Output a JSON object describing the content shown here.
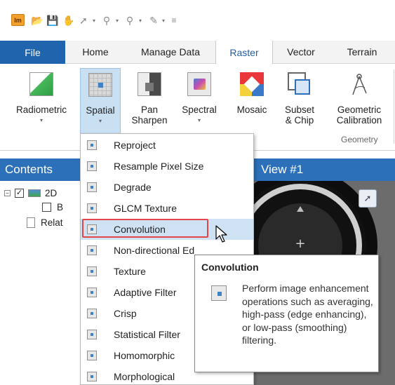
{
  "quick_access": {
    "logo_text": "Im",
    "icons": [
      "open-folder-icon",
      "save-icon",
      "pan-icon",
      "select-icon",
      "zoom-in-icon",
      "zoom-out-icon",
      "draw-icon",
      "customize-icon"
    ]
  },
  "tabs": [
    {
      "label": "File"
    },
    {
      "label": "Home"
    },
    {
      "label": "Manage Data"
    },
    {
      "label": "Raster"
    },
    {
      "label": "Vector"
    },
    {
      "label": "Terrain"
    }
  ],
  "ribbon": {
    "buttons": [
      {
        "label": "Radiometric",
        "icon": "radiometric-icon"
      },
      {
        "label": "Spatial",
        "icon": "spatial-icon"
      },
      {
        "label": "Pan\nSharpen",
        "icon": "pan-sharpen-icon"
      },
      {
        "label": "Spectral",
        "icon": "spectral-icon"
      },
      {
        "label": "Mosaic",
        "icon": "mosaic-icon"
      },
      {
        "label": "Subset\n& Chip",
        "icon": "subset-chip-icon"
      },
      {
        "label": "Geometric\nCalibration",
        "icon": "geometric-calibration-icon"
      }
    ],
    "group_label": "Geometry"
  },
  "contents": {
    "header": "Contents",
    "rows": [
      {
        "label": "2D"
      },
      {
        "label": "B"
      },
      {
        "label": "Relat"
      }
    ]
  },
  "view": {
    "header": "View #1"
  },
  "menu": {
    "items": [
      "Reproject",
      "Resample Pixel Size",
      "Degrade",
      "GLCM Texture",
      "Convolution",
      "Non-directional Ed",
      "Texture",
      "Adaptive Filter",
      "Crisp",
      "Statistical Filter",
      "Homomorphic",
      "Morphological"
    ],
    "hovered_item": "Convolution"
  },
  "tooltip": {
    "title": "Convolution",
    "body": "Perform image enhancement operations such as averaging, high-pass (edge enhancing), or low-pass (smoothing) filtering."
  },
  "colors": {
    "accent_blue": "#2b70b8",
    "menu_hover": "#cfe2f4",
    "highlight_red": "#e2454a"
  }
}
